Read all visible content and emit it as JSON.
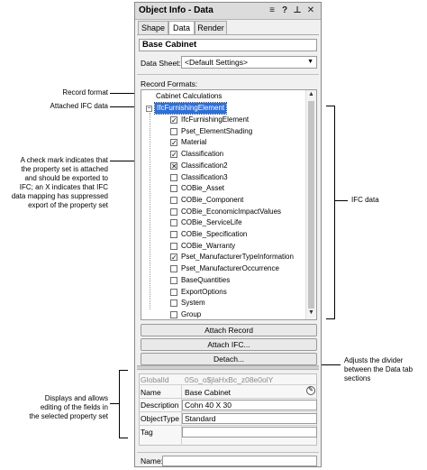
{
  "window": {
    "title": "Object Info - Data",
    "icons": [
      "menu-icon",
      "help-icon",
      "pin-icon",
      "close-icon"
    ],
    "help_glyph": "?",
    "close_glyph": "✕",
    "pin_glyph": "⊥",
    "menu_glyph": "≡"
  },
  "tabs": [
    {
      "label": "Shape",
      "active": false
    },
    {
      "label": "Data",
      "active": true
    },
    {
      "label": "Render",
      "active": false
    }
  ],
  "object_name": "Base Cabinet",
  "data_sheet": {
    "label": "Data Sheet:",
    "value": "<Default Settings>"
  },
  "record_formats": {
    "label": "Record Formats:",
    "record": "Cabinet Calculations",
    "ifc_root": "IfcFurnishingElement",
    "items": [
      {
        "label": "IfcFurnishingElement",
        "state": "checked"
      },
      {
        "label": "Pset_ElementShading",
        "state": "unchecked"
      },
      {
        "label": "Material",
        "state": "checked"
      },
      {
        "label": "Classification",
        "state": "checked"
      },
      {
        "label": "Classification2",
        "state": "x"
      },
      {
        "label": "Classification3",
        "state": "unchecked"
      },
      {
        "label": "COBie_Asset",
        "state": "unchecked"
      },
      {
        "label": "COBie_Component",
        "state": "unchecked"
      },
      {
        "label": "COBie_EconomicImpactValues",
        "state": "unchecked"
      },
      {
        "label": "COBie_ServiceLife",
        "state": "unchecked"
      },
      {
        "label": "COBie_Specification",
        "state": "unchecked"
      },
      {
        "label": "COBie_Warranty",
        "state": "unchecked"
      },
      {
        "label": "Pset_ManufacturerTypeInformation",
        "state": "checked"
      },
      {
        "label": "Pset_ManufacturerOccurrence",
        "state": "unchecked"
      },
      {
        "label": "BaseQuantities",
        "state": "unchecked"
      },
      {
        "label": "ExportOptions",
        "state": "unchecked"
      },
      {
        "label": "System",
        "state": "unchecked"
      },
      {
        "label": "Group",
        "state": "unchecked"
      }
    ]
  },
  "buttons": {
    "attach_record": "Attach Record",
    "attach_ifc": "Attach IFC...",
    "detach": "Detach..."
  },
  "fields": {
    "global_id_label": "GlobalId",
    "global_id_value": "0So_o$jlaHxBc_z08e0olY",
    "name_label": "Name",
    "name_value": "Base Cabinet",
    "description_label": "Description",
    "description_value": "Cohn 40 X 30",
    "object_type_label": "ObjectType",
    "object_type_value": "Standard",
    "tag_label": "Tag",
    "tag_value": ""
  },
  "footer": {
    "name_label": "Name:",
    "name_value": ""
  },
  "annotations": {
    "record_format": "Record format",
    "attached_ifc": "Attached IFC data",
    "checkmark": [
      "A check mark indicates that",
      "the property set is attached",
      "and should be exported to",
      "IFC; an X indicates that IFC",
      "data mapping has suppressed",
      "export of the property set"
    ],
    "ifc_data": "IFC data",
    "divider": [
      "Adjusts the divider",
      "between the Data tab",
      "sections"
    ],
    "fields": [
      "Displays and allows",
      "editing of the fields in",
      "the selected property set"
    ]
  }
}
